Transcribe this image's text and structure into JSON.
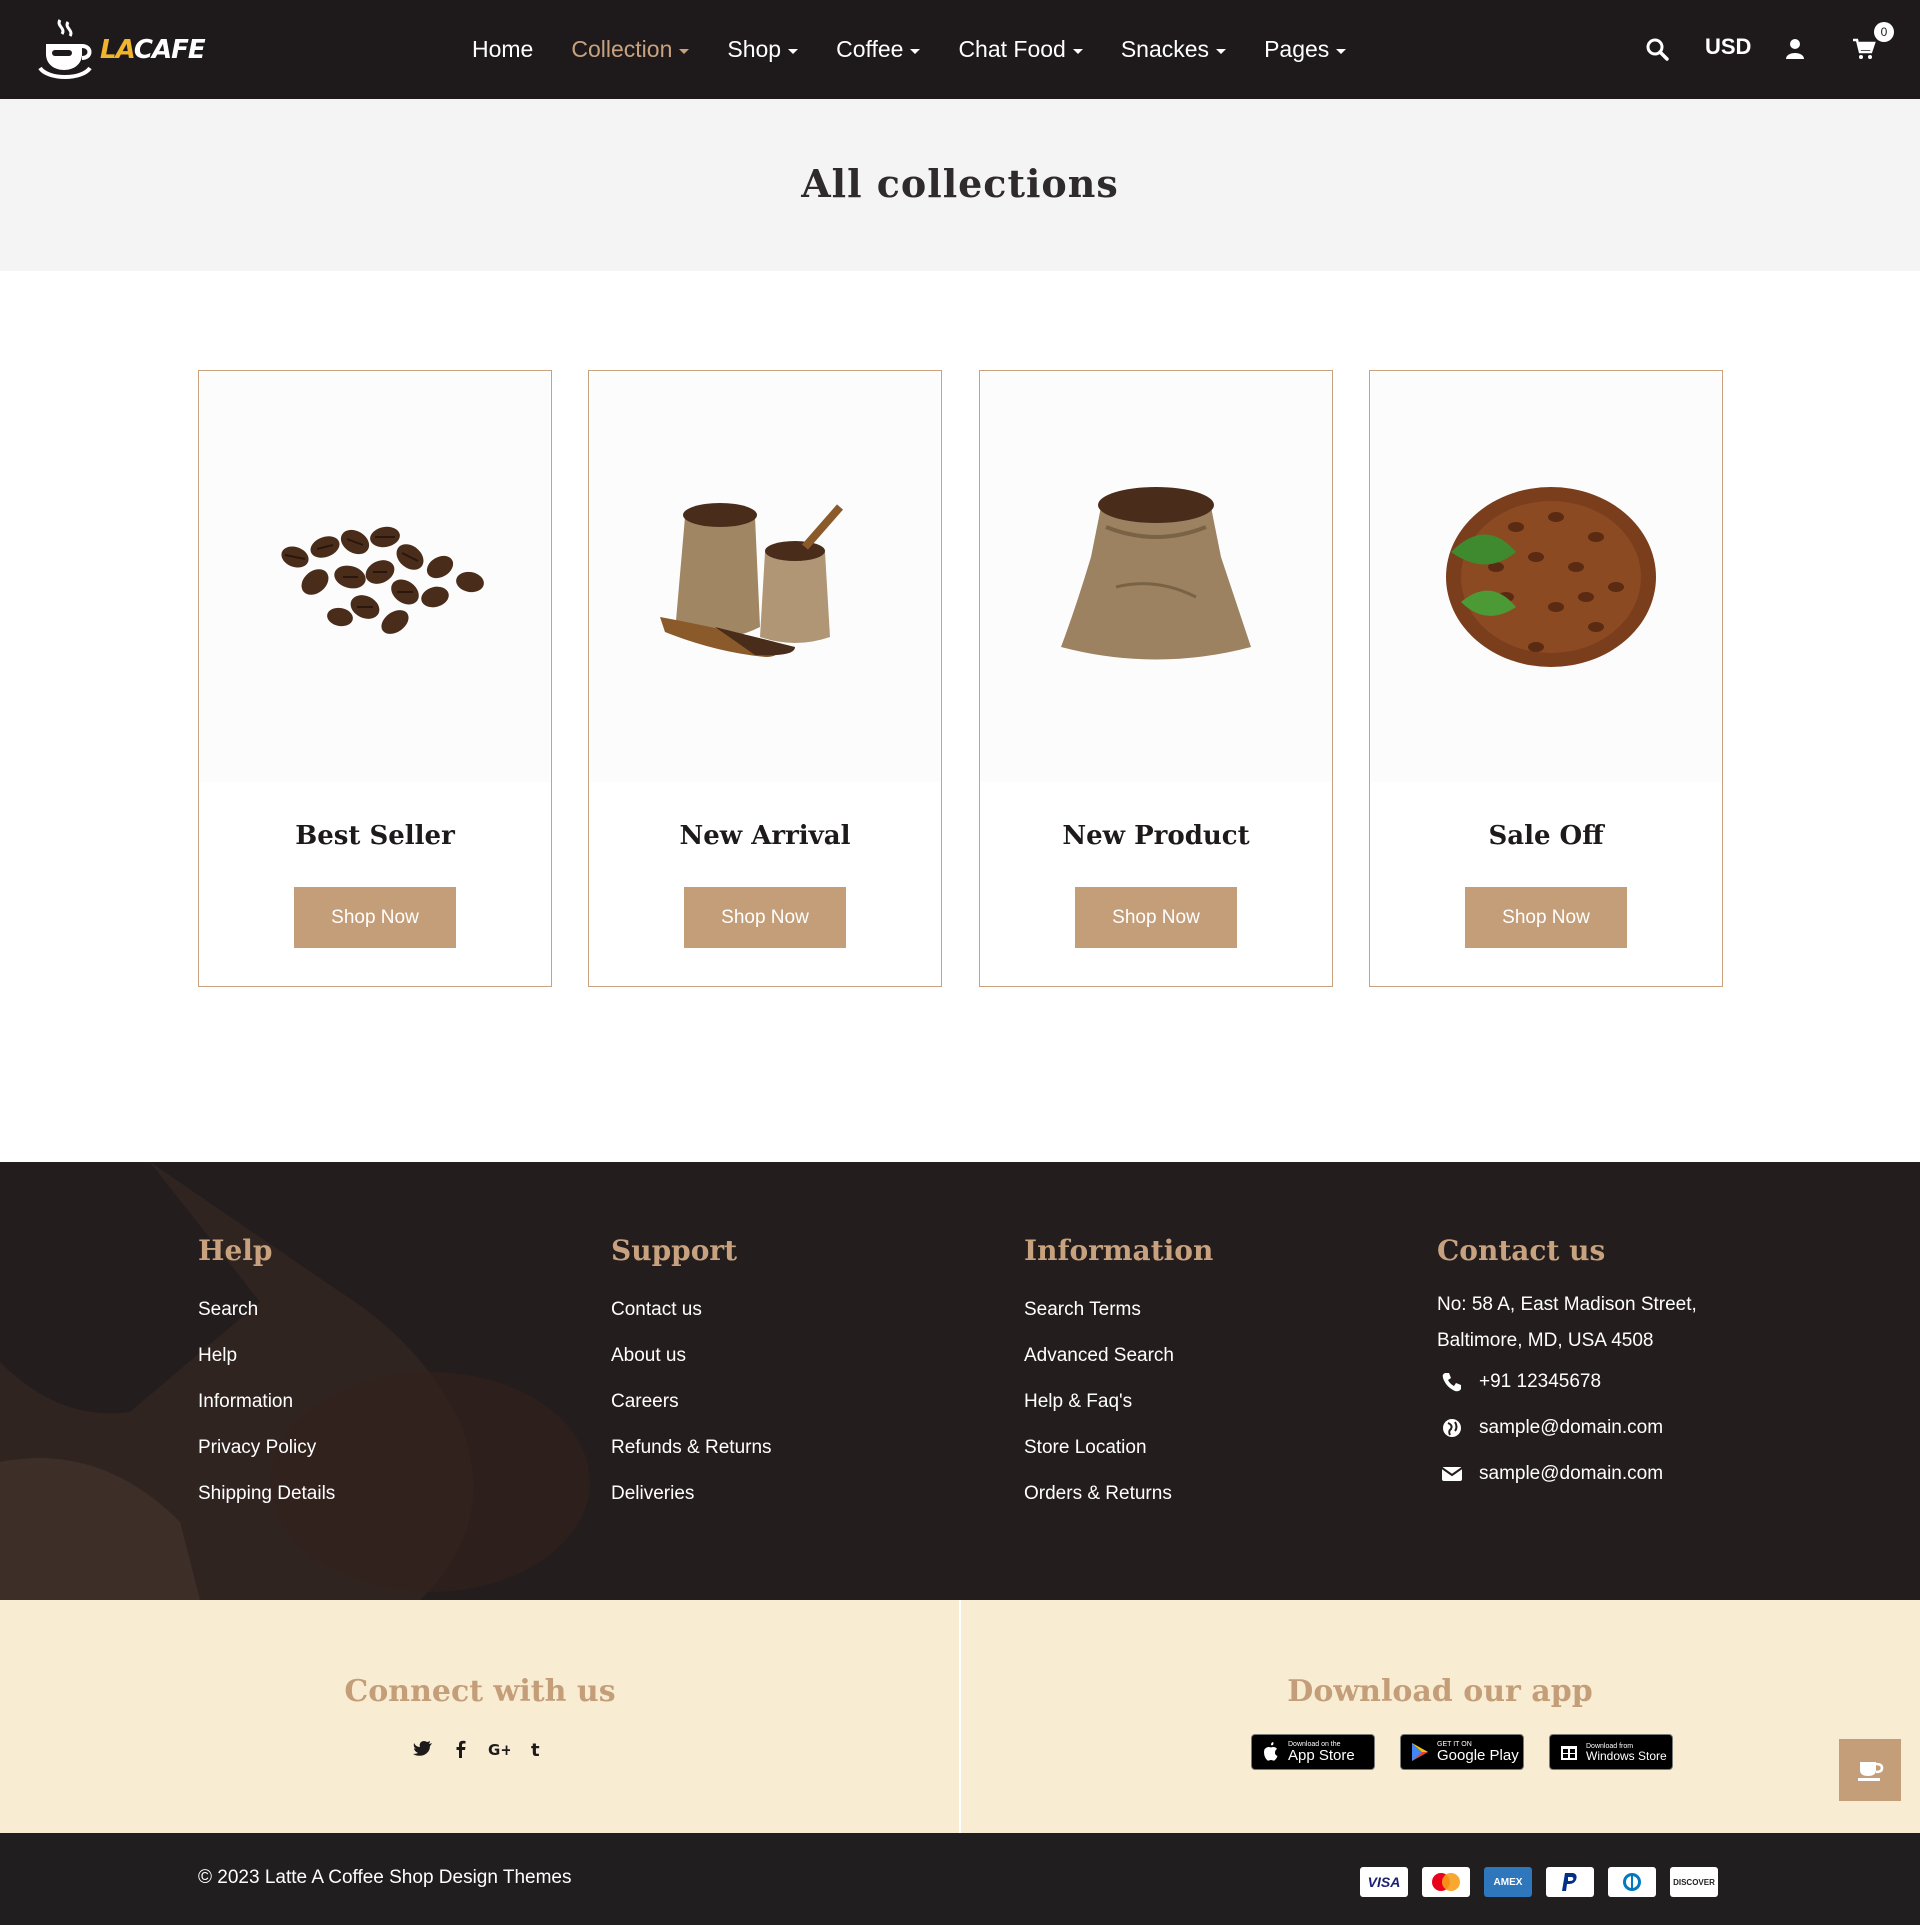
{
  "brand": {
    "logo_la": "LA",
    "logo_cafe": "CAFE",
    "accent": "#c8a27e",
    "dark": "#1e1a1b",
    "cream": "#f8ecd3"
  },
  "nav": {
    "items": [
      {
        "label": "Home",
        "caret": false
      },
      {
        "label": "Collection",
        "caret": true
      },
      {
        "label": "Shop",
        "caret": true
      },
      {
        "label": "Coffee",
        "caret": true
      },
      {
        "label": "Chat Food",
        "caret": true
      },
      {
        "label": "Snackes",
        "caret": true
      },
      {
        "label": "Pages",
        "caret": true
      }
    ],
    "active": "Collection"
  },
  "header": {
    "currency": "USD",
    "cart_count": "0",
    "icons": [
      "search-icon",
      "user-icon",
      "cart-icon"
    ]
  },
  "page": {
    "title": "All collections"
  },
  "collections": [
    {
      "title": "Best Seller",
      "button": "Shop Now",
      "image": "coffee-beans-pile"
    },
    {
      "title": "New Arrival",
      "button": "Shop Now",
      "image": "burlap-sacks-with-scoop"
    },
    {
      "title": "New Product",
      "button": "Shop Now",
      "image": "burlap-sack"
    },
    {
      "title": "Sale Off",
      "button": "Shop Now",
      "image": "beans-with-leaves"
    }
  ],
  "footer": {
    "help": {
      "title": "Help",
      "links": [
        "Search",
        "Help",
        "Information",
        "Privacy Policy",
        "Shipping Details"
      ]
    },
    "support": {
      "title": "Support",
      "links": [
        "Contact us",
        "About us",
        "Careers",
        "Refunds & Returns",
        "Deliveries"
      ]
    },
    "information": {
      "title": "Information",
      "links": [
        "Search Terms",
        "Advanced Search",
        "Help & Faq's",
        "Store Location",
        "Orders & Returns"
      ]
    },
    "contact": {
      "title": "Contact us",
      "address_line1": "No: 58 A, East Madison Street,",
      "address_line2": "Baltimore, MD, USA 4508",
      "phone": "+91 12345678",
      "email1": "sample@domain.com",
      "email2": "sample@domain.com"
    }
  },
  "connect": {
    "title": "Connect with us",
    "icons": [
      "twitter-icon",
      "facebook-icon",
      "google-plus-icon",
      "tumblr-icon"
    ]
  },
  "download": {
    "title": "Download our app",
    "stores": [
      {
        "small": "Download on the",
        "big": "App Store"
      },
      {
        "small": "GET IT ON",
        "big": "Google Play"
      },
      {
        "small": "Download from",
        "big": "Windows Store"
      }
    ]
  },
  "bottom": {
    "copyright": "© 2023 Latte A Coffee Shop Design Themes",
    "payments": [
      "VISA",
      "mastercard",
      "AMEX",
      "PayPal",
      "Diners",
      "DISCOVER"
    ]
  }
}
